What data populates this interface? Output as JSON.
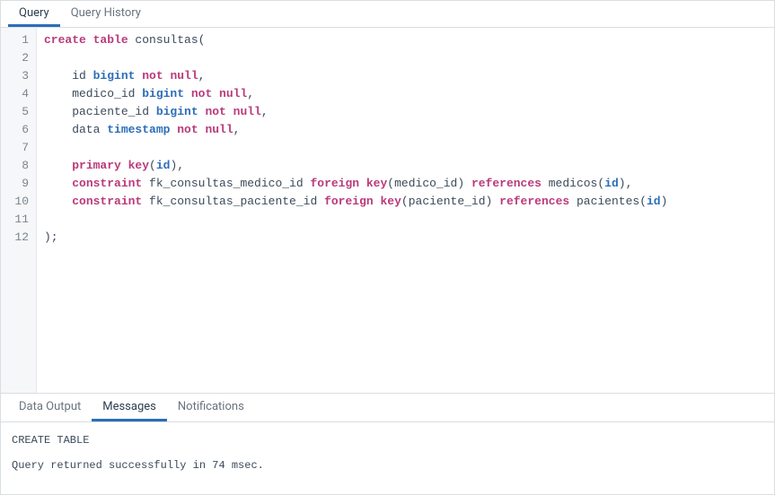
{
  "tabs": {
    "query": "Query",
    "history": "Query History"
  },
  "code_lines": [
    [
      [
        "kw1",
        "create table"
      ],
      [
        "ident",
        " consultas"
      ],
      [
        "punct",
        "("
      ]
    ],
    [],
    [
      [
        "ident",
        "    id "
      ],
      [
        "kw2",
        "bigint"
      ],
      [
        "ident",
        " "
      ],
      [
        "kw3",
        "not null"
      ],
      [
        "punct",
        ","
      ]
    ],
    [
      [
        "ident",
        "    medico_id "
      ],
      [
        "kw2",
        "bigint"
      ],
      [
        "ident",
        " "
      ],
      [
        "kw3",
        "not null"
      ],
      [
        "punct",
        ","
      ]
    ],
    [
      [
        "ident",
        "    paciente_id "
      ],
      [
        "kw2",
        "bigint"
      ],
      [
        "ident",
        " "
      ],
      [
        "kw3",
        "not null"
      ],
      [
        "punct",
        ","
      ]
    ],
    [
      [
        "ident",
        "    data "
      ],
      [
        "kw2",
        "timestamp"
      ],
      [
        "ident",
        " "
      ],
      [
        "kw3",
        "not null"
      ],
      [
        "punct",
        ","
      ]
    ],
    [],
    [
      [
        "ident",
        "    "
      ],
      [
        "kw1",
        "primary key"
      ],
      [
        "punct",
        "("
      ],
      [
        "idbold",
        "id"
      ],
      [
        "punct",
        "),"
      ]
    ],
    [
      [
        "ident",
        "    "
      ],
      [
        "kw1",
        "constraint"
      ],
      [
        "ident",
        " fk_consultas_medico_id "
      ],
      [
        "kw1",
        "foreign key"
      ],
      [
        "punct",
        "("
      ],
      [
        "ident",
        "medico_id"
      ],
      [
        "punct",
        ") "
      ],
      [
        "kw1",
        "references"
      ],
      [
        "ident",
        " medicos"
      ],
      [
        "punct",
        "("
      ],
      [
        "idbold",
        "id"
      ],
      [
        "punct",
        "),"
      ]
    ],
    [
      [
        "ident",
        "    "
      ],
      [
        "kw1",
        "constraint"
      ],
      [
        "ident",
        " fk_consultas_paciente_id "
      ],
      [
        "kw1",
        "foreign key"
      ],
      [
        "punct",
        "("
      ],
      [
        "ident",
        "paciente_id"
      ],
      [
        "punct",
        ") "
      ],
      [
        "kw1",
        "references"
      ],
      [
        "ident",
        " pacientes"
      ],
      [
        "punct",
        "("
      ],
      [
        "idbold",
        "id"
      ],
      [
        "punct",
        ")"
      ]
    ],
    [],
    [
      [
        "punct",
        ");"
      ]
    ]
  ],
  "output_tabs": {
    "data_output": "Data Output",
    "messages": "Messages",
    "notifications": "Notifications"
  },
  "messages": {
    "line1": "CREATE TABLE",
    "line2": "Query returned successfully in 74 msec."
  }
}
